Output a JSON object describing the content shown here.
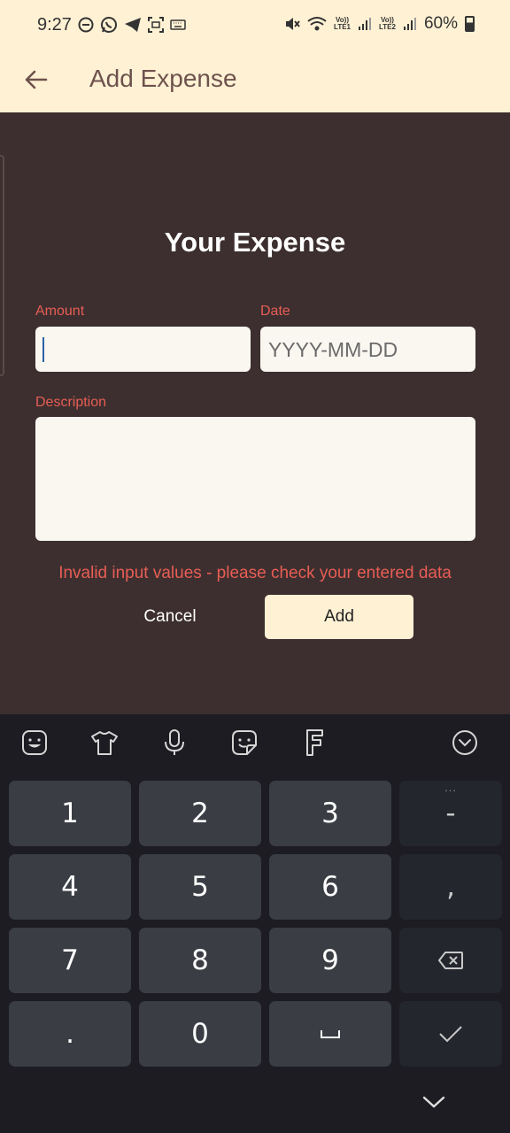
{
  "status_bar": {
    "time": "9:27",
    "sim1_top": "Vo))",
    "sim1_bottom": "LTE1",
    "sim2_top": "Vo))",
    "sim2_bottom": "LTE2",
    "battery": "60%"
  },
  "app_bar": {
    "title": "Add Expense",
    "back_icon": "arrow-left-icon"
  },
  "form": {
    "title": "Your Expense",
    "amount_label": "Amount",
    "amount_value": "",
    "date_label": "Date",
    "date_placeholder": "YYYY-MM-DD",
    "description_label": "Description",
    "description_value": "",
    "error": "Invalid input values - please check your entered data",
    "cancel_label": "Cancel",
    "add_label": "Add"
  },
  "keyboard": {
    "toolbar": [
      "emoji-icon",
      "theme-shirt-icon",
      "microphone-icon",
      "sticker-icon",
      "font-icon",
      "chevron-down-circle-icon"
    ],
    "keys": {
      "k1": "1",
      "k2": "2",
      "k3": "3",
      "minus": "-",
      "k4": "4",
      "k5": "5",
      "k6": "6",
      "comma": ",",
      "k7": "7",
      "k8": "8",
      "k9": "9",
      "dot": ".",
      "k0": "0"
    },
    "more_indicator": "...",
    "special_keys": [
      "backspace-icon",
      "space-icon",
      "done-check-icon",
      "hide-keyboard-icon"
    ]
  },
  "colors": {
    "header_bg": "#fff1d4",
    "page_bg": "#3d2f2f",
    "accent_red": "#e85d55",
    "title_brown": "#6e524d",
    "keyboard_bg": "#1c1c22",
    "key_bg": "#3a3d44"
  }
}
